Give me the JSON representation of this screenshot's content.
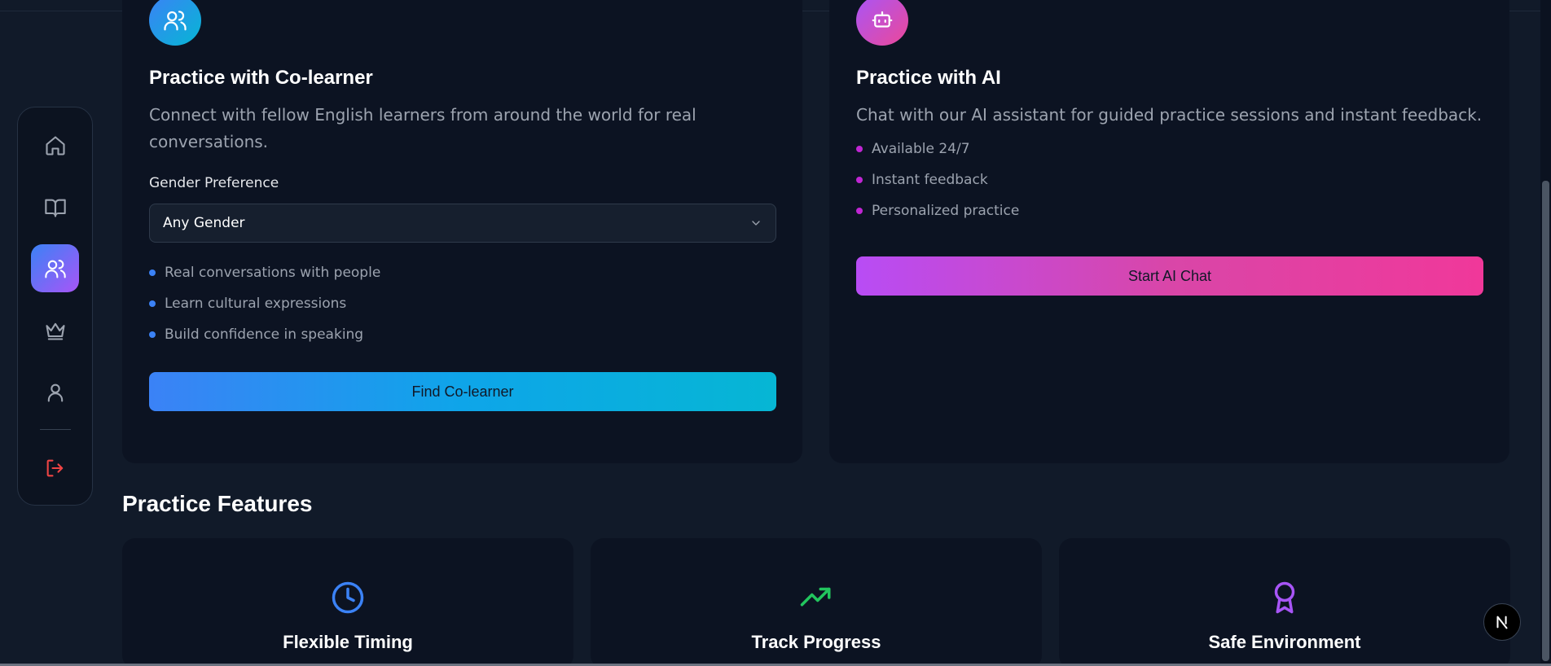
{
  "sidebar": {
    "items": [
      {
        "icon": "home-icon",
        "active": false
      },
      {
        "icon": "book-icon",
        "active": false
      },
      {
        "icon": "users-icon",
        "active": true
      },
      {
        "icon": "crown-icon",
        "active": false
      },
      {
        "icon": "user-icon",
        "active": false
      },
      {
        "icon": "logout-icon",
        "active": false
      }
    ]
  },
  "colearner_card": {
    "icon": "users-icon",
    "title": "Practice with Co-learner",
    "description": "Connect with fellow English learners from around the world for real conversations.",
    "gender_label": "Gender Preference",
    "gender_value": "Any Gender",
    "bullets": [
      "Real conversations with people",
      "Learn cultural expressions",
      "Build confidence in speaking"
    ],
    "button_label": "Find Co-learner"
  },
  "ai_card": {
    "icon": "bot-icon",
    "title": "Practice with AI",
    "description": "Chat with our AI assistant for guided practice sessions and instant feedback.",
    "bullets": [
      "Available 24/7",
      "Instant feedback",
      "Personalized practice"
    ],
    "button_label": "Start AI Chat"
  },
  "features": {
    "title": "Practice Features",
    "items": [
      {
        "icon": "clock-icon",
        "title": "Flexible Timing",
        "color": "#3b82f6"
      },
      {
        "icon": "trending-up-icon",
        "title": "Track Progress",
        "color": "#22c55e"
      },
      {
        "icon": "award-icon",
        "title": "Safe Environment",
        "color": "#a855f7"
      }
    ]
  },
  "colors": {
    "background": "#111a29",
    "card": "#0c1322",
    "accent_blue": "#3b82f6",
    "accent_pink": "#ec4899",
    "logout_red": "#ef4444"
  }
}
